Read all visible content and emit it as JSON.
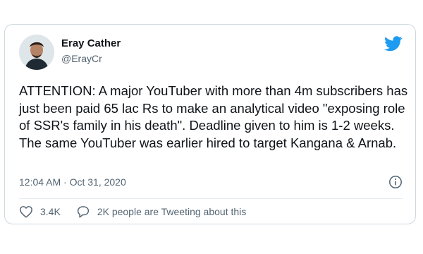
{
  "author": {
    "name": "Eray Cather",
    "handle": "@ErayCr"
  },
  "tweet": {
    "text": "ATTENTION: A major YouTuber with more than 4m subscribers has just been paid 65 lac Rs to make an analytical video \"exposing role of SSR's family in his death\". Deadline given to him is 1-2 weeks. The same YouTuber was earlier hired to target Kangana & Arnab.",
    "timestamp": "12:04 AM · Oct 31, 2020"
  },
  "actions": {
    "likes": "3.4K",
    "conversation": "2K people are Tweeting about this"
  },
  "icons": {
    "brand": "twitter-bird-icon",
    "info": "info-icon",
    "like": "heart-icon",
    "reply": "speech-bubble-icon"
  },
  "colors": {
    "brand_blue": "#1d9bf0",
    "text": "#0f1419",
    "muted": "#536471",
    "border": "#cfd9de"
  }
}
